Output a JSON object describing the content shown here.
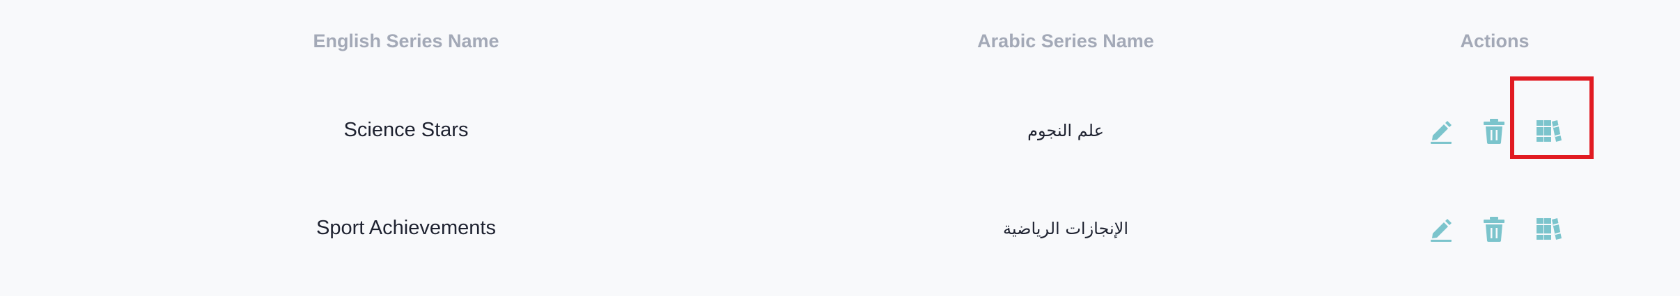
{
  "table": {
    "columns": {
      "english": "English Series Name",
      "arabic": "Arabic Series Name",
      "actions": "Actions"
    },
    "rows": [
      {
        "english": "Science Stars",
        "arabic": "علم النجوم"
      },
      {
        "english": "Sport Achievements",
        "arabic": "الإنجازات الرياضية"
      }
    ],
    "action_icons": [
      "pencil-icon",
      "trash-icon",
      "books-icon"
    ]
  },
  "colors": {
    "icon": "#7bc4cc",
    "header_text": "#a3a9b7",
    "body_text": "#1e2230",
    "highlight": "#e11b22",
    "background": "#f8f9fb"
  }
}
